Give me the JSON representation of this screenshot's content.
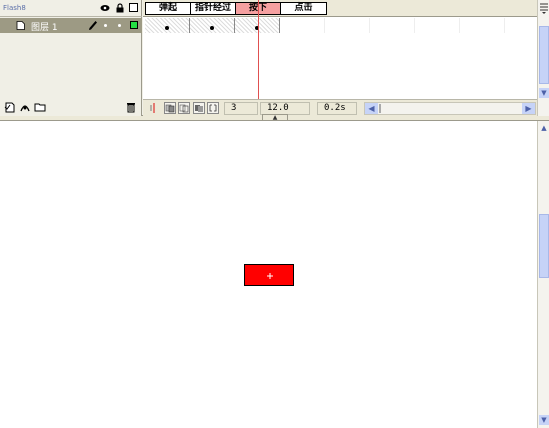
{
  "timeline": {
    "scene_name": "Flash8",
    "frame_tabs": [
      {
        "label": "弹起",
        "active": false
      },
      {
        "label": "指针经过",
        "active": false
      },
      {
        "label": "按下",
        "active": true
      },
      {
        "label": "点击",
        "active": false
      }
    ],
    "layer": {
      "name": "图层 1",
      "color": "#22dd44"
    },
    "status": {
      "current_frame": "3",
      "frame_rate": "12.0 fps",
      "elapsed_time": "0.2s"
    },
    "collapse_glyph": "▲"
  },
  "scroll": {
    "left_arrow": "◀",
    "right_arrow": "▶",
    "up_arrow": "▲",
    "down_arrow": "▼"
  },
  "stage": {
    "button_color": "#ff0000"
  }
}
